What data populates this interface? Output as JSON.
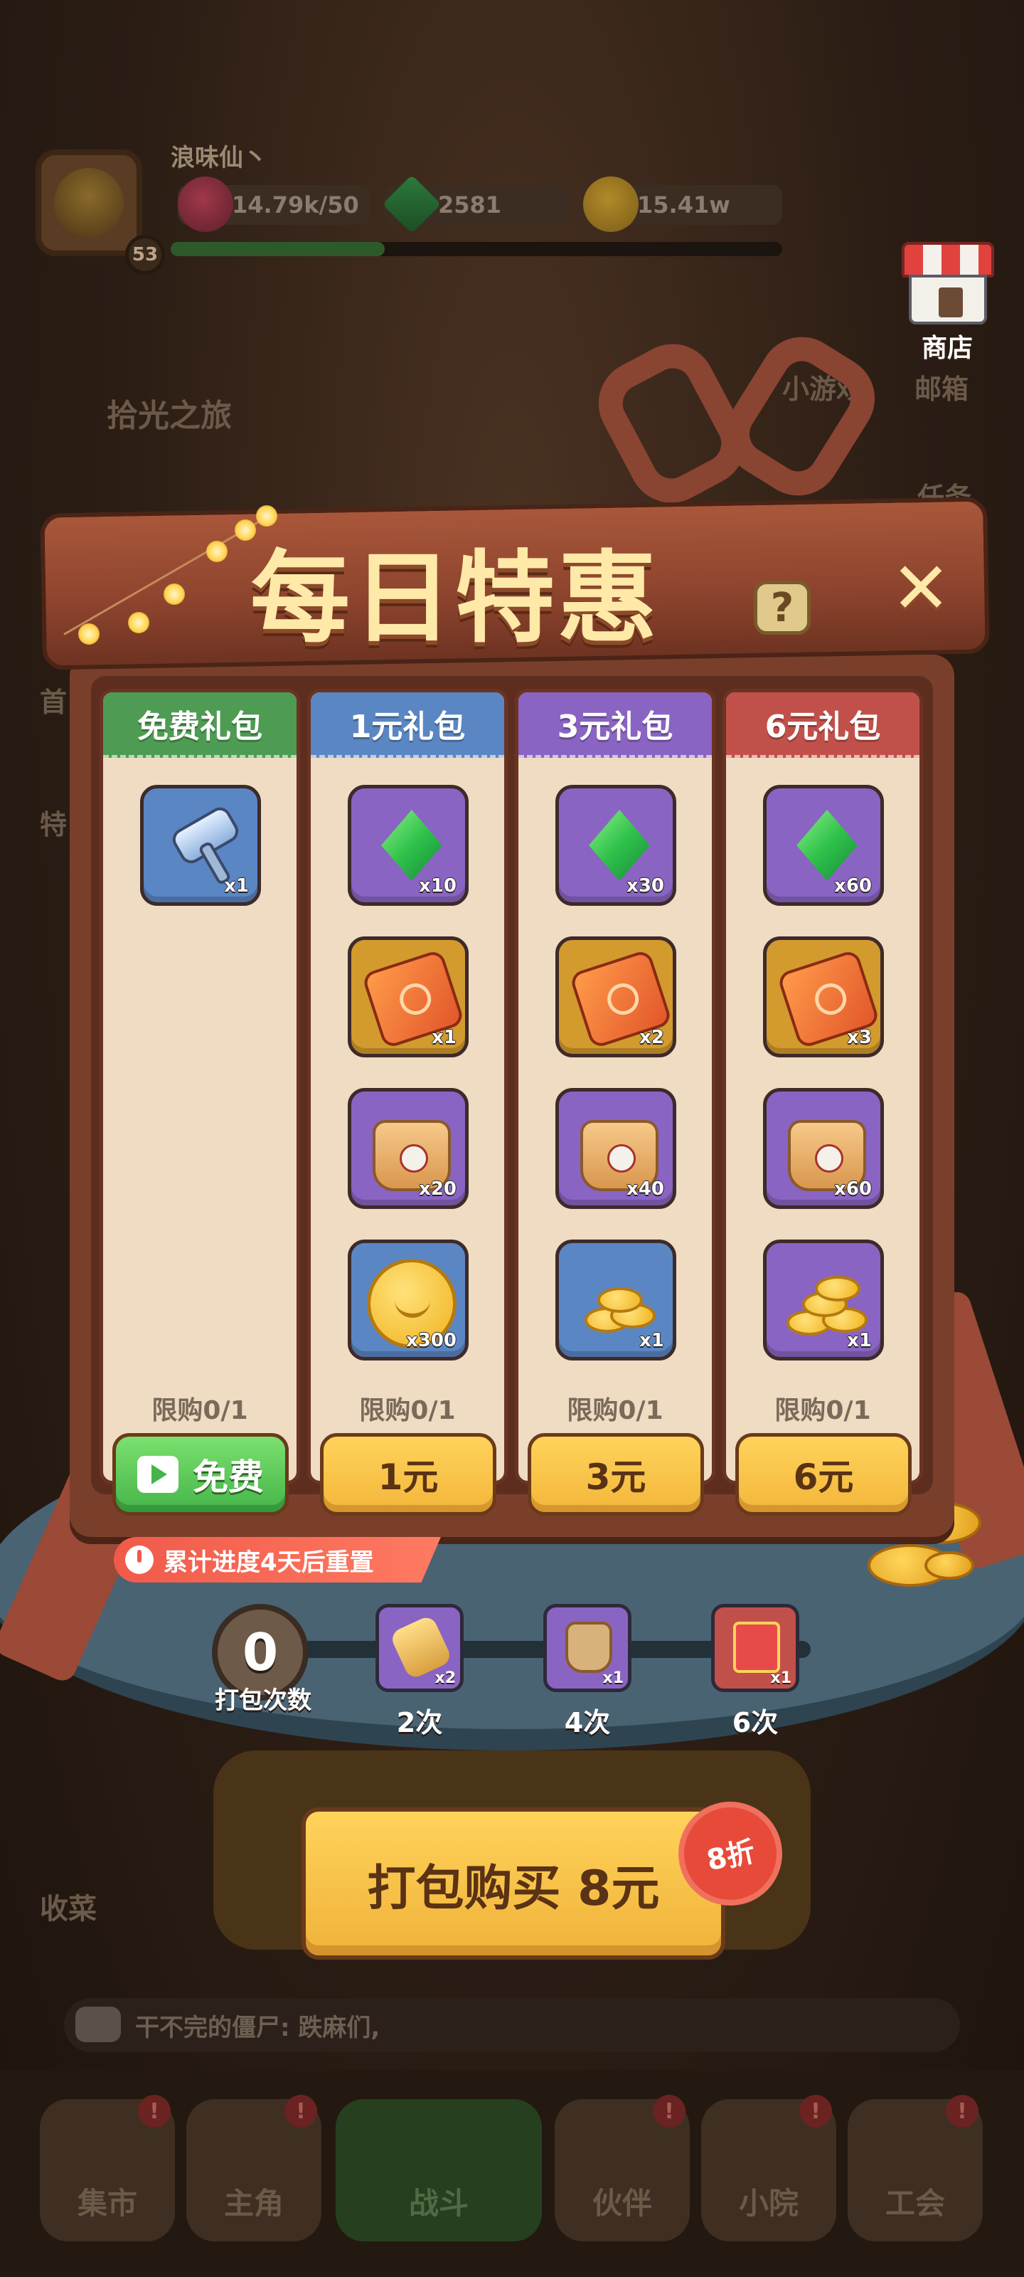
{
  "hud": {
    "player_name": "浪味仙丶",
    "level": "53",
    "meat": "14.79k/50",
    "gems": "2581",
    "coins": "15.41w",
    "xp_progress": 0.35
  },
  "side_menu": {
    "shop": "商店",
    "mini_game": "小游戏",
    "mailbox": "邮箱",
    "task": "任务",
    "event_banner": "拾光之旅",
    "first": "首",
    "special": "特"
  },
  "popup": {
    "title": "每日特惠",
    "help": "?",
    "close": "✕",
    "columns": [
      {
        "header": "免费礼包",
        "items": [
          {
            "icon": "hammer-icon",
            "qty": "x1"
          }
        ],
        "limit": "限购0/1",
        "button": "免费"
      },
      {
        "header": "1元礼包",
        "items": [
          {
            "icon": "gem-icon",
            "qty": "x10"
          },
          {
            "icon": "scroll-icon",
            "qty": "x1"
          },
          {
            "icon": "food-bag-icon",
            "qty": "x20"
          },
          {
            "icon": "coin-icon",
            "qty": "x300"
          }
        ],
        "limit": "限购0/1",
        "button": "1元"
      },
      {
        "header": "3元礼包",
        "items": [
          {
            "icon": "gem-icon",
            "qty": "x30"
          },
          {
            "icon": "scroll-icon",
            "qty": "x2"
          },
          {
            "icon": "food-bag-icon",
            "qty": "x40"
          },
          {
            "icon": "coin-pile-icon",
            "qty": "x1"
          }
        ],
        "limit": "限购0/1",
        "button": "3元"
      },
      {
        "header": "6元礼包",
        "items": [
          {
            "icon": "gem-icon",
            "qty": "x60"
          },
          {
            "icon": "scroll-icon",
            "qty": "x3"
          },
          {
            "icon": "food-bag-icon",
            "qty": "x60"
          },
          {
            "icon": "coin-pile-icon",
            "qty": "x1"
          }
        ],
        "limit": "限购0/1",
        "button": "6元"
      }
    ],
    "reset_notice": "累计进度4天后重置",
    "bundle": {
      "count": "0",
      "count_label": "打包次数",
      "milestones": [
        {
          "icon": "hammer-icon",
          "qty": "x2",
          "label": "2次"
        },
        {
          "icon": "mystery-bag-icon",
          "qty": "x1",
          "label": "4次"
        },
        {
          "icon": "mystery-chest-icon",
          "qty": "x1",
          "label": "6次"
        }
      ],
      "buy_label": "打包购买 8元",
      "discount": "8折"
    }
  },
  "background": {
    "battle_label": "战斗",
    "harvest_label": "收菜",
    "chat": "干不完的僵尸: 跌麻们,"
  },
  "nav": {
    "items": [
      "集市",
      "主角",
      "战斗",
      "伙伴",
      "小院",
      "工会"
    ],
    "badge": "!"
  }
}
